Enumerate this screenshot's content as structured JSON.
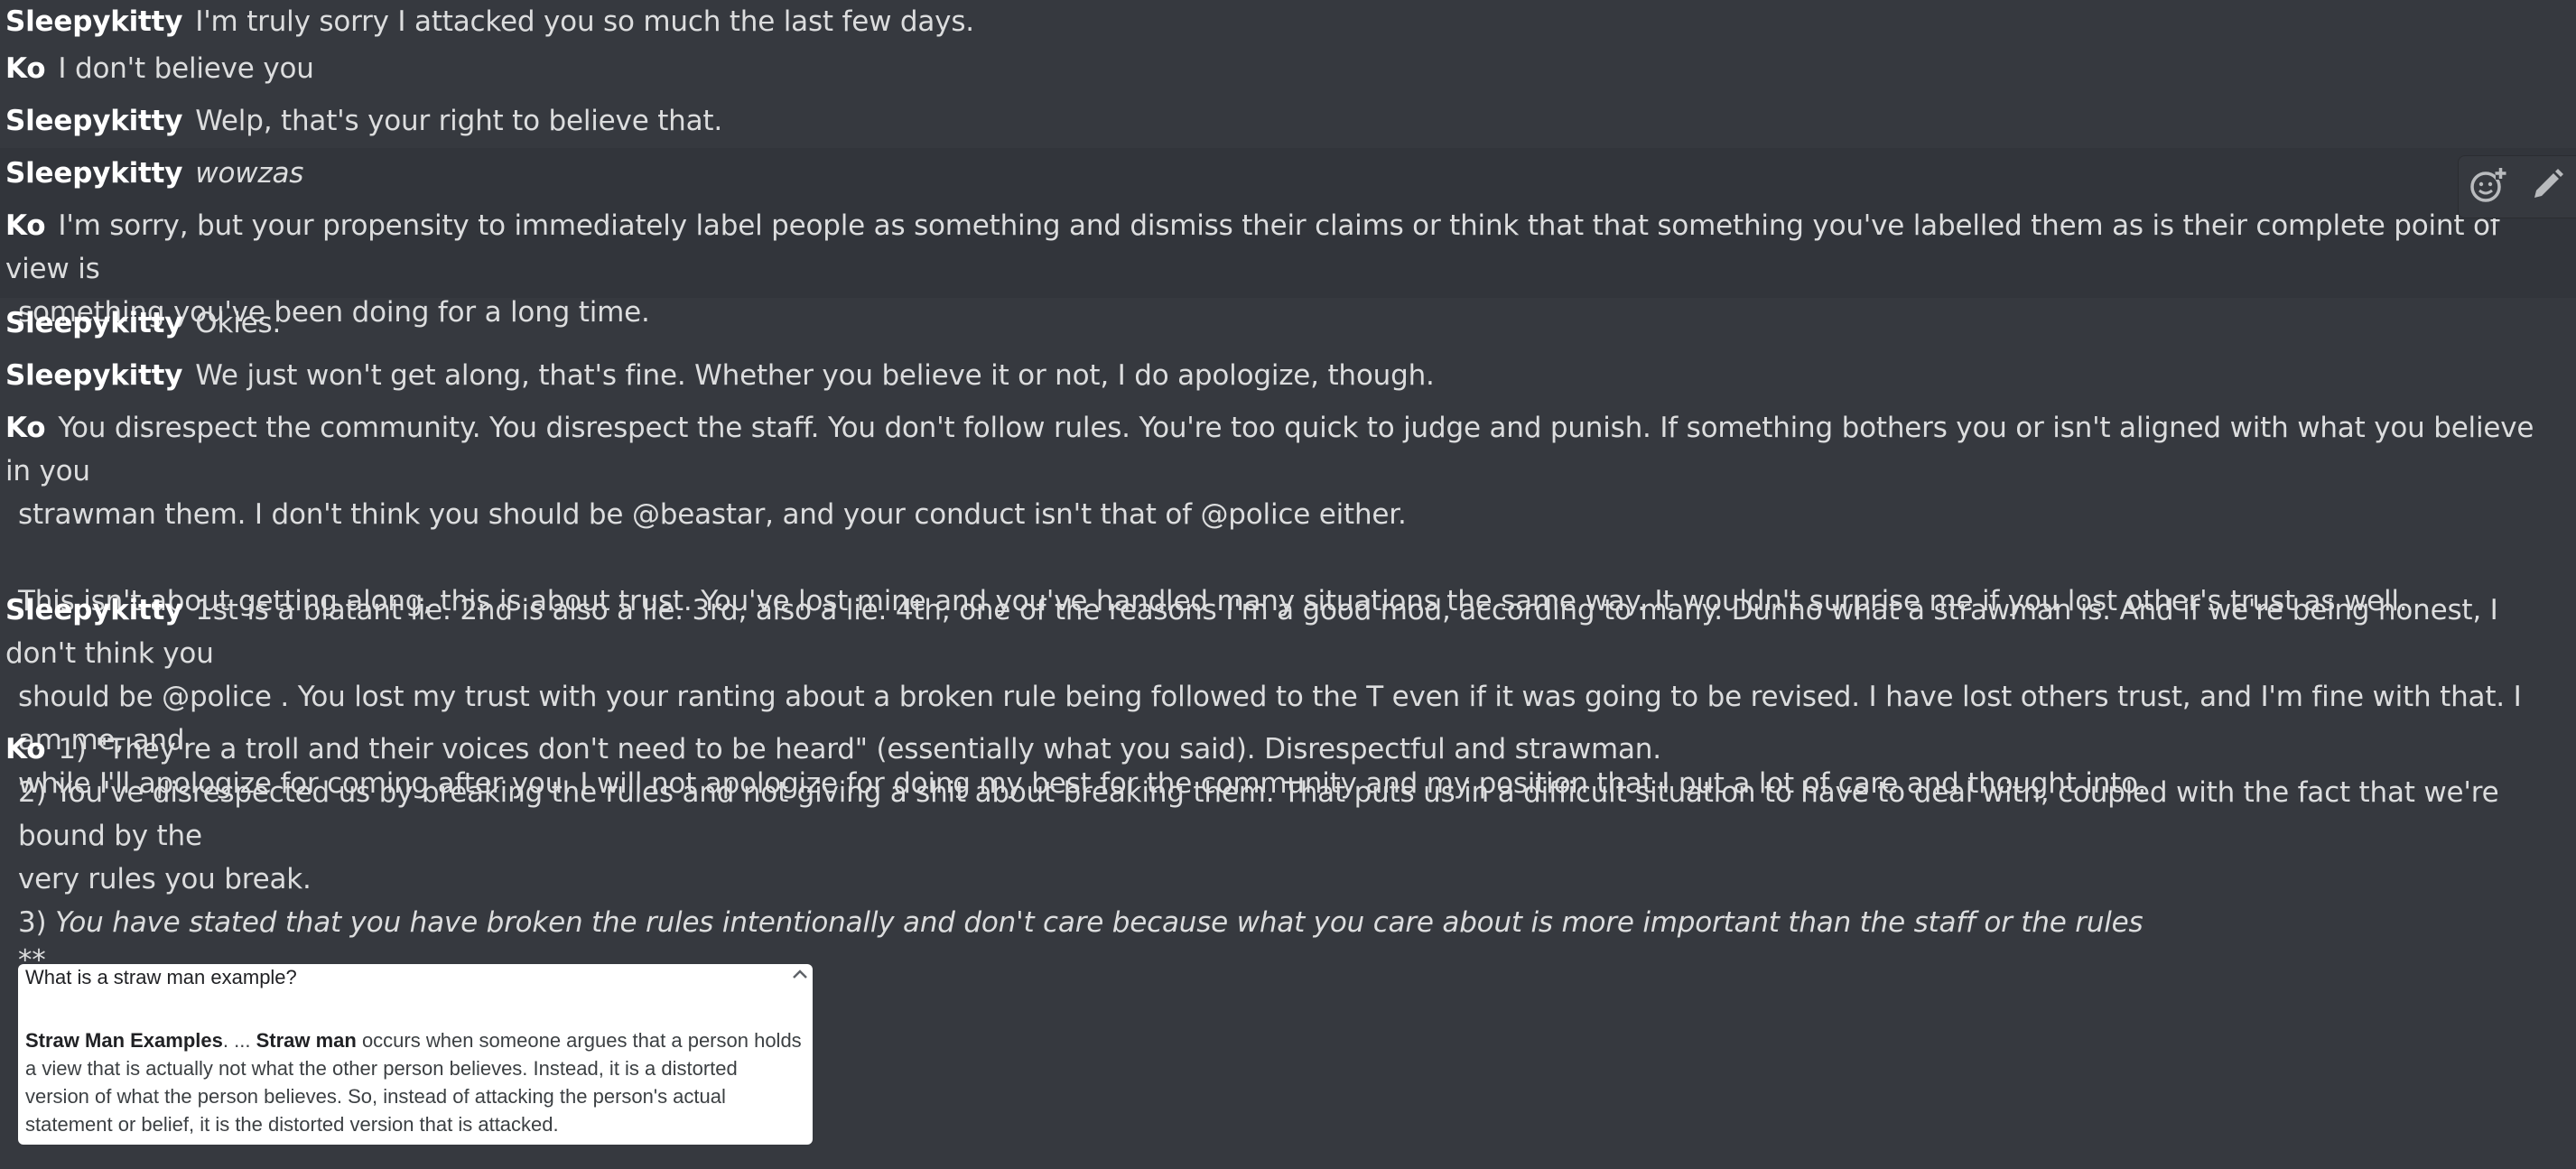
{
  "messages": [
    {
      "author": "Sleepykitty",
      "text": "I'm truly sorry I attacked you so much the last few days."
    },
    {
      "author": "Ko",
      "text": "I don't believe you"
    },
    {
      "author": "Sleepykitty",
      "text": "Welp, that's your right to believe that."
    },
    {
      "author": "Sleepykitty",
      "text": "wowzas"
    },
    {
      "author": "Ko",
      "line1": "I'm sorry, but your propensity to immediately label people as something and dismiss their claims or think that that something you've labelled them as is their complete point of view is",
      "line2": "something you've been doing for a long time."
    },
    {
      "author": "Sleepykitty",
      "text": "Okies."
    },
    {
      "author": "Sleepykitty",
      "text": "We just won't get along, that's fine.  Whether you believe it or not, I do apologize, though."
    },
    {
      "author": "Ko",
      "line1": "You disrespect the community.  You disrespect the staff.  You don't follow rules.  You're too quick to judge and punish.  If something bothers you or isn't aligned with what you believe in you",
      "line2": "strawman them.  I don't think you should be @beastar, and your conduct isn't that of @police either.",
      "line3": "This isn't about getting along, this is about trust.  You've lost mine and you've handled many situations the same way.  It wouldn't surprise me if you lost other's trust as well."
    },
    {
      "author": "Sleepykitty",
      "line1": "1st is a blatant lie.  2nd is also a lie.  3rd, also a lie.  4th, one of the reasons I'm a good mod, according to many.  Dunno what a strawman is.  And if we're being honest, I don't think you",
      "line2": "should be @police .  You lost my trust with your ranting about a broken rule being followed to the T even if it was going to be revised.  I have lost others trust, and I'm fine with that.  I am me, and",
      "line3": "while I'll apologize for coming after you, I will not apologize for doing my best for the community and my position that I put a lot of care and thought into."
    },
    {
      "author": "Ko",
      "line1": "1) \"They're a troll and their voices don't need to be heard\" (essentially what you said).  Disrespectful and strawman.",
      "line2": "2) You've disrespected us by breaking the rules and not giving a shit about breaking them.  That puts us in a difficult situation to have to deal with, coupled with the fact that we're bound by the",
      "line3": "very rules you break.",
      "line4_prefix": "3) ",
      "line4_italic": "You have stated that you have broken the rules intentionally and don't care because what you care about is more important than the staff or the rules",
      "line5": "**"
    }
  ],
  "embed": {
    "question": "What is a straw man example?",
    "chevron": "^",
    "bold1": "Straw Man Examples",
    "text1": ". ... ",
    "bold2": "Straw man",
    "line1_rest": " occurs when someone argues that a person holds",
    "line2": "a view that is actually not what the other person believes. Instead, it is a distorted",
    "line3": "version of what the person believes. So, instead of attacking the person's actual",
    "line4": "statement or belief, it is the distorted version that is attacked."
  },
  "toolbar": {
    "icons": [
      "add-reaction-icon",
      "edit-icon"
    ]
  },
  "colors": {
    "background": "#36393f",
    "hover_background": "#32353b",
    "text": "#dcddde",
    "author": "#ffffff"
  }
}
